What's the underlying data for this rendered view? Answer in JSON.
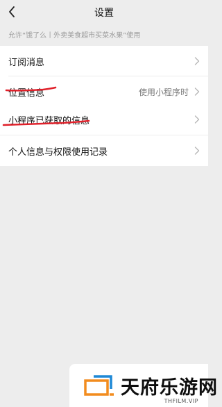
{
  "nav": {
    "title": "设置"
  },
  "hint": "允许“饿了么丨外卖美食超市买菜水果”使用",
  "groups": [
    {
      "rows": [
        {
          "label": "订阅消息",
          "value": ""
        },
        {
          "label": "位置信息",
          "value": "使用小程序时"
        }
      ]
    },
    {
      "rows": [
        {
          "label": "小程序已获取的信息",
          "value": ""
        }
      ]
    },
    {
      "rows": [
        {
          "label": "个人信息与权限使用记录",
          "value": ""
        }
      ]
    }
  ],
  "watermark": {
    "brand": "天府乐游网",
    "site": "THFILM.VIP"
  },
  "colors": {
    "background": "#ededed",
    "card": "#ffffff",
    "annotation": "#e0202a",
    "logo_orange": "#f28c1e",
    "logo_blue": "#1e88d6"
  }
}
